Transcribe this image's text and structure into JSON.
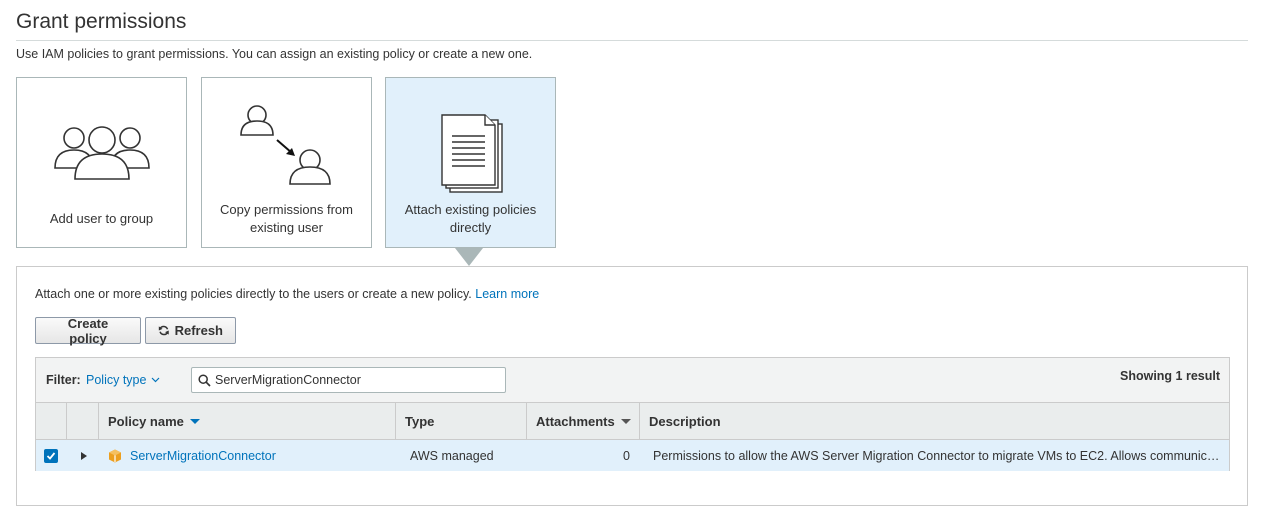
{
  "page": {
    "title": "Grant permissions",
    "intro": "Use IAM policies to grant permissions. You can assign an existing policy or create a new one."
  },
  "options": [
    {
      "label": "Add user to group",
      "icon": "group-icon",
      "selected": false
    },
    {
      "label": "Copy permissions from existing user",
      "icon": "copy-user-icon",
      "selected": false
    },
    {
      "label": "Attach existing policies directly",
      "icon": "document-stack-icon",
      "selected": true
    }
  ],
  "panel": {
    "description": "Attach one or more existing policies directly to the users or create a new policy.",
    "learn_more": "Learn more",
    "create_policy_label": "Create policy",
    "refresh_label": "Refresh"
  },
  "filter": {
    "label": "Filter:",
    "type_label": "Policy type",
    "search_value": "ServerMigrationConnector",
    "result_count": "Showing 1 result"
  },
  "table": {
    "columns": [
      "Policy name",
      "Type",
      "Attachments",
      "Description"
    ],
    "rows": [
      {
        "checked": true,
        "name": "ServerMigrationConnector",
        "type": "AWS managed",
        "attachments": "0",
        "description": "Permissions to allow the AWS Server Migration Connector to migrate VMs to EC2. Allows communication with the AWS Server Migration Service, read/write to the S3 bucket, and discovery of connectors."
      }
    ]
  },
  "colors": {
    "accent": "#0073bb",
    "selected_bg": "#e1f0fb",
    "policy_icon": "#ec9f1f"
  }
}
